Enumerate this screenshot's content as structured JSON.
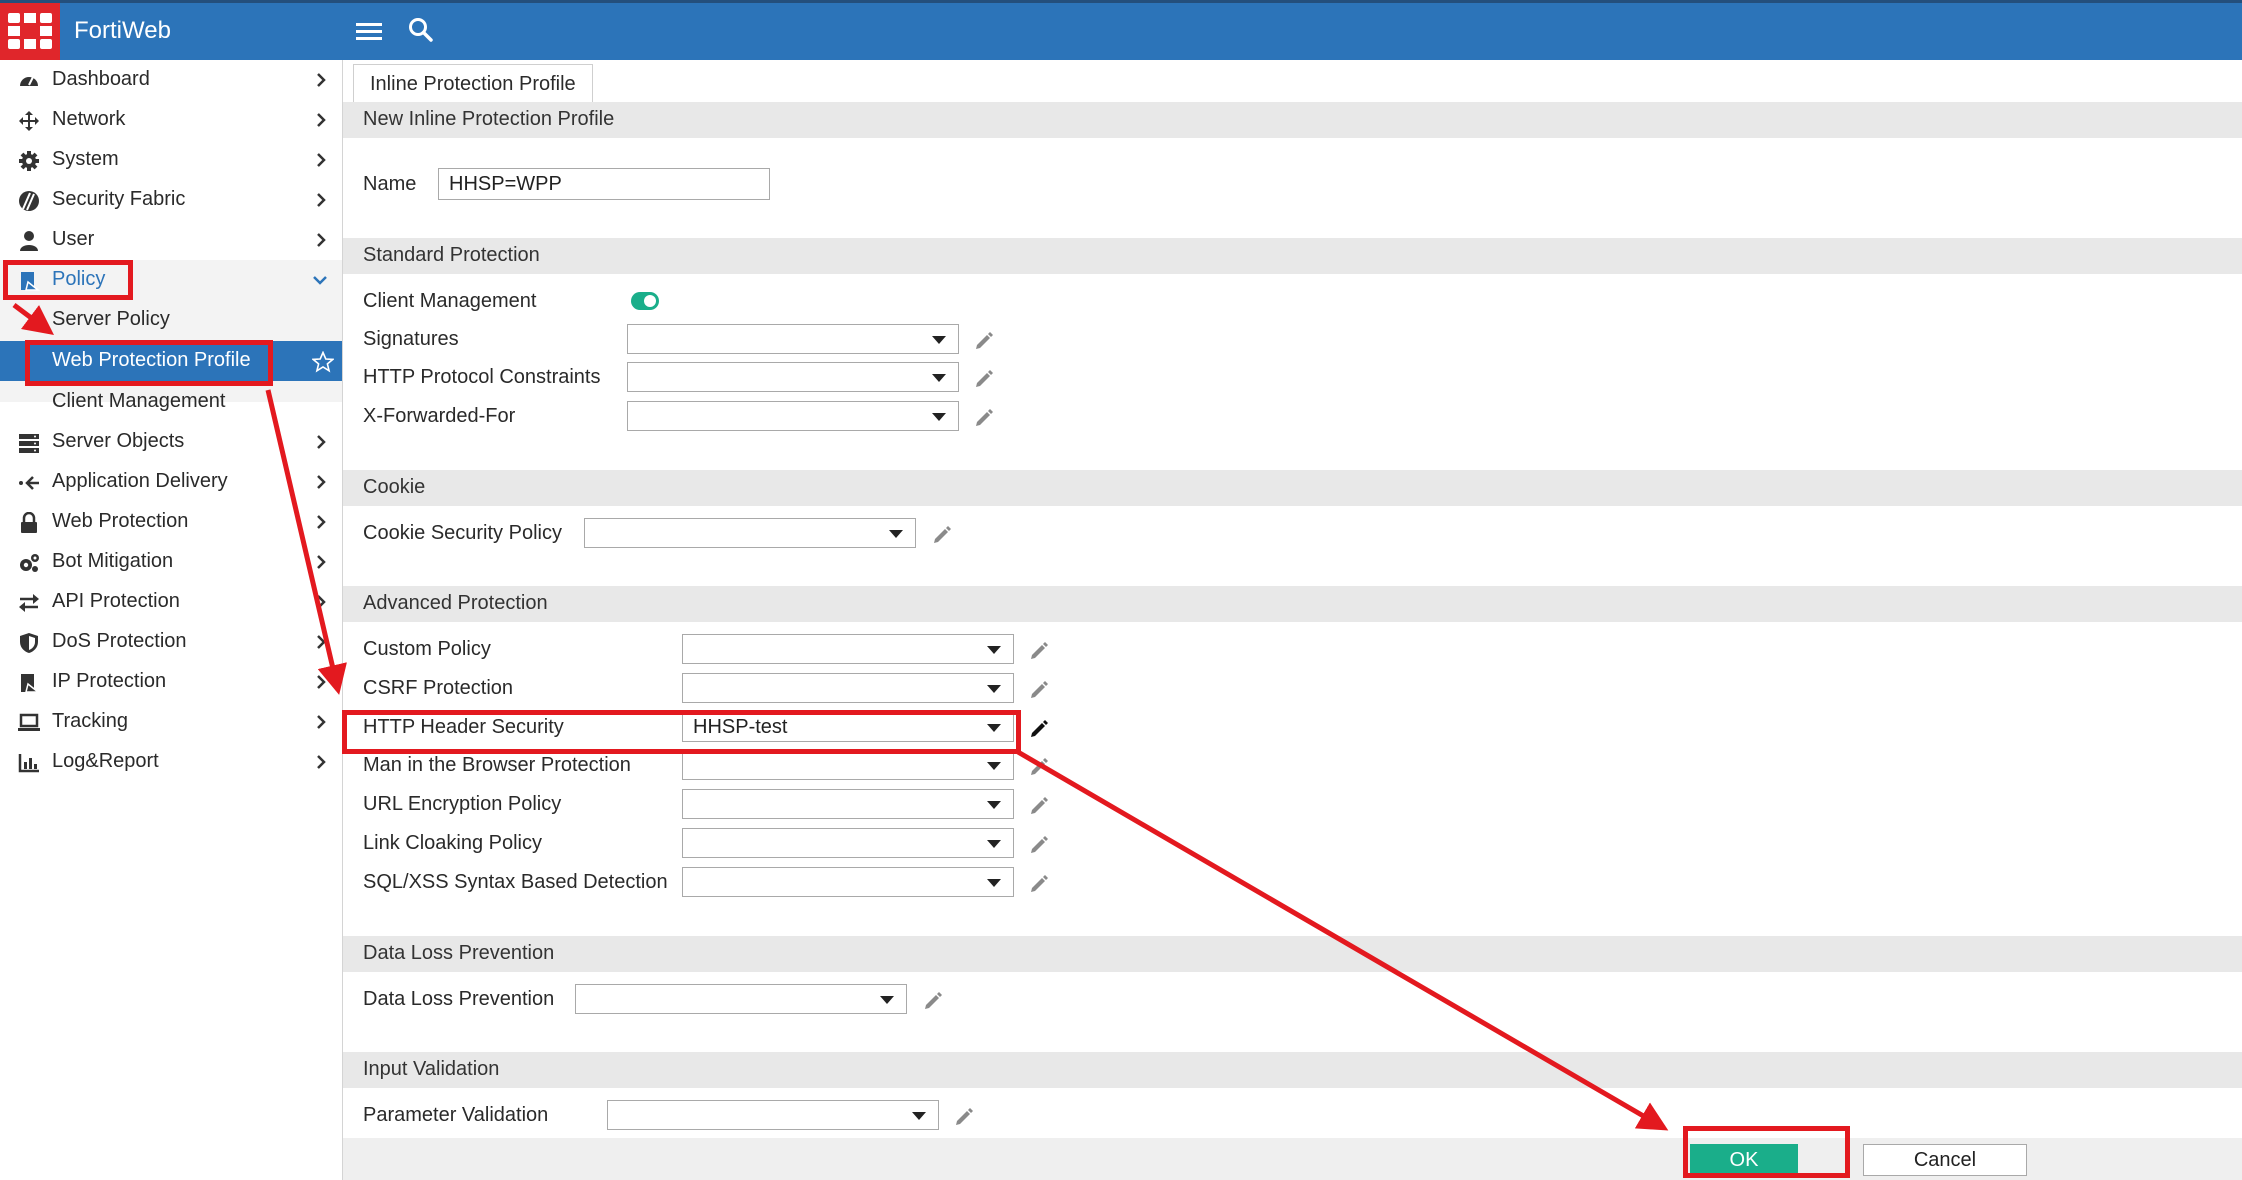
{
  "app": {
    "brand": "FortiWeb"
  },
  "sidebar": {
    "items": [
      {
        "label": "Dashboard",
        "icon": "dashboard-icon"
      },
      {
        "label": "Network",
        "icon": "network-icon"
      },
      {
        "label": "System",
        "icon": "gear-icon"
      },
      {
        "label": "Security Fabric",
        "icon": "security-fabric-icon"
      },
      {
        "label": "User",
        "icon": "user-icon"
      },
      {
        "label": "Policy",
        "icon": "policy-icon"
      },
      {
        "label": "Server Objects",
        "icon": "server-icon"
      },
      {
        "label": "Application Delivery",
        "icon": "app-delivery-icon"
      },
      {
        "label": "Web Protection",
        "icon": "lock-icon"
      },
      {
        "label": "Bot Mitigation",
        "icon": "cogs-icon"
      },
      {
        "label": "API Protection",
        "icon": "exchange-icon"
      },
      {
        "label": "DoS Protection",
        "icon": "shield-icon"
      },
      {
        "label": "IP Protection",
        "icon": "ip-protection-icon"
      },
      {
        "label": "Tracking",
        "icon": "laptop-icon"
      },
      {
        "label": "Log&Report",
        "icon": "bar-chart-icon"
      }
    ],
    "policy_sub": [
      {
        "label": "Server Policy"
      },
      {
        "label": "Web Protection Profile"
      },
      {
        "label": "Client Management"
      }
    ]
  },
  "tab": {
    "label": "Inline Protection Profile"
  },
  "form": {
    "title": "New Inline Protection Profile",
    "name_label": "Name",
    "name_value": "HHSP=WPP",
    "standard": {
      "heading": "Standard Protection",
      "client_mgmt_label": "Client Management",
      "client_mgmt_enabled": true,
      "signatures_label": "Signatures",
      "http_protocol_label": "HTTP Protocol Constraints",
      "xff_label": "X-Forwarded-For"
    },
    "cookie": {
      "heading": "Cookie",
      "cookie_policy_label": "Cookie Security Policy"
    },
    "advanced": {
      "heading": "Advanced Protection",
      "custom_policy_label": "Custom Policy",
      "csrf_label": "CSRF Protection",
      "http_header_label": "HTTP Header Security",
      "http_header_value": "HHSP-test",
      "mitb_label": "Man in the Browser Protection",
      "url_enc_label": "URL Encryption Policy",
      "link_cloak_label": "Link Cloaking Policy",
      "sqlxss_label": "SQL/XSS Syntax Based Detection"
    },
    "dlp": {
      "heading": "Data Loss Prevention",
      "dlp_label": "Data Loss Prevention"
    },
    "input": {
      "heading": "Input Validation",
      "param_label": "Parameter Validation"
    }
  },
  "buttons": {
    "ok": "OK",
    "cancel": "Cancel"
  },
  "colors": {
    "topbar": "#2c74b9",
    "logo": "#e0262b",
    "active_nav": "#2c74b9",
    "ok_button": "#1aae8a",
    "annotation": "#e3191f"
  }
}
